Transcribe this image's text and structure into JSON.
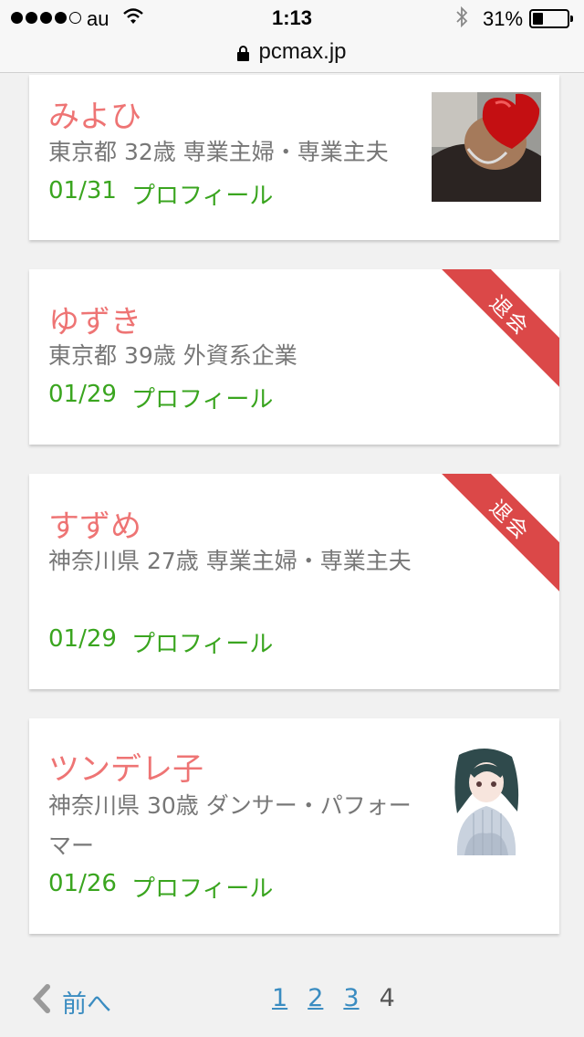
{
  "status_bar": {
    "carrier": "au",
    "time": "1:13",
    "battery_text": "31%",
    "battery_level": 0.31
  },
  "browser": {
    "url": "pcmax.jp"
  },
  "cards": [
    {
      "name": "みよひ",
      "info": "東京都 32歳 専業主婦・専業主夫",
      "date": "01/31",
      "profile_link": "プロフィール"
    },
    {
      "name": "ゆずき",
      "info": "東京都 39歳 外資系企業",
      "date": "01/29",
      "profile_link": "プロフィール",
      "badge": "退会"
    },
    {
      "name": "すずめ",
      "info": "神奈川県 27歳 専業主婦・専業主夫",
      "date": "01/29",
      "profile_link": "プロフィール",
      "badge": "退会"
    },
    {
      "name": "ツンデレ子",
      "info": "神奈川県 30歳 ダンサー・パフォーマー",
      "date": "01/26",
      "profile_link": "プロフィール"
    }
  ],
  "pagination": {
    "prev_label": "前へ",
    "pages": [
      "1",
      "2",
      "3"
    ],
    "current": "4"
  },
  "colors": {
    "name": "#ee7474",
    "meta": "#3aa51f",
    "link": "#3a8cc1",
    "badge": "#db4848",
    "background": "#f1f1f1"
  }
}
